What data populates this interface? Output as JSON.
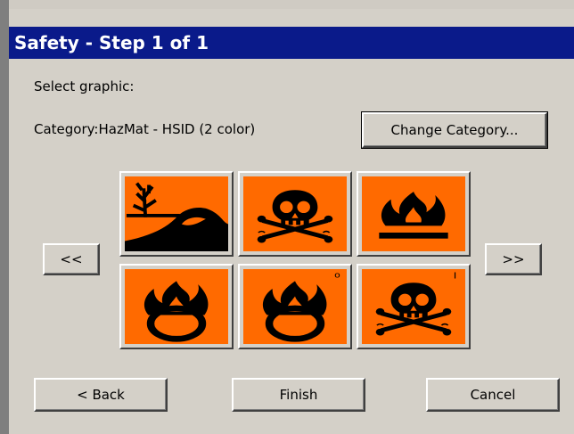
{
  "window": {
    "title": "Safety - Step 1 of 1"
  },
  "prompt": "Select graphic:",
  "category": {
    "text": "Category:HazMat - HSID (2 color)",
    "change_label": "Change Category..."
  },
  "nav": {
    "prev_label": "<<",
    "next_label": ">>"
  },
  "symbols": [
    {
      "icon": "environmental-hazard-icon"
    },
    {
      "icon": "toxic-skull-crossbones-icon"
    },
    {
      "icon": "flammable-flame-icon"
    },
    {
      "icon": "oxidizer-flame-over-circle-icon"
    },
    {
      "icon": "oxidizer-flame-over-circle-icon",
      "mark": "o"
    },
    {
      "icon": "toxic-skull-crossbones-icon",
      "mark": "I"
    }
  ],
  "colors": {
    "symbol_bg": "#ff6a00",
    "titlebar": "#0a1a8a"
  },
  "footer": {
    "back_label": "< Back",
    "finish_label": "Finish",
    "cancel_label": "Cancel"
  }
}
